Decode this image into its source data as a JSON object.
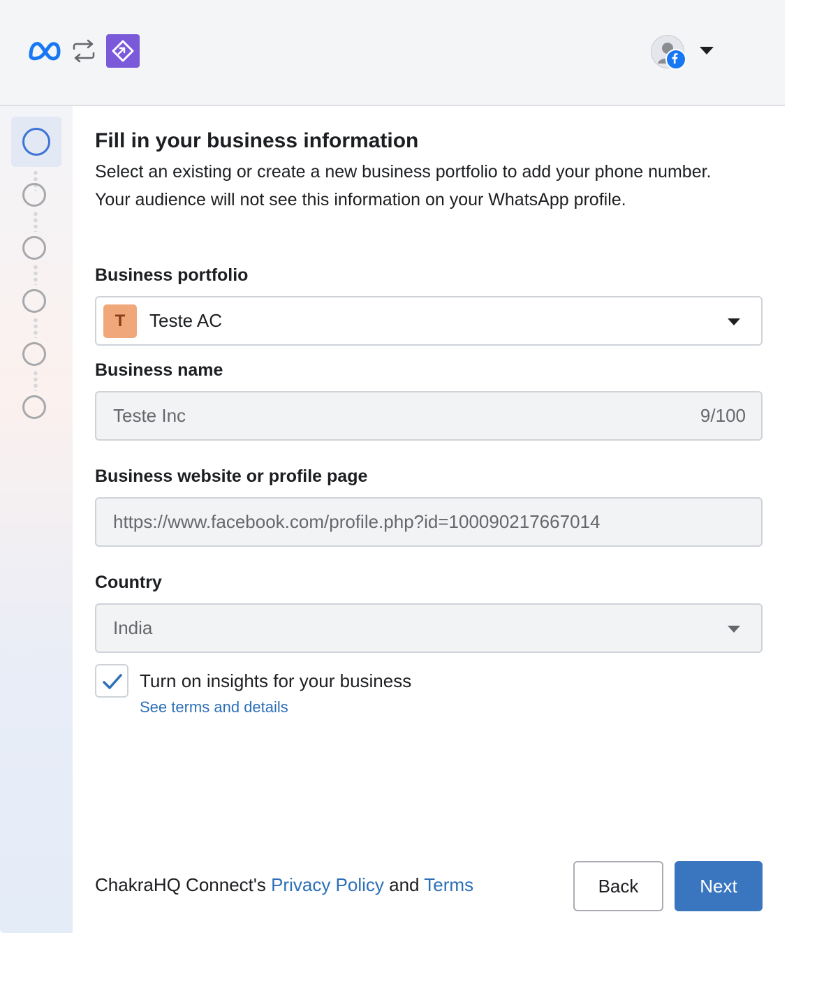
{
  "header": {
    "meta_logo_icon": "meta-infinity-icon",
    "swap_icon": "swap-arrows-icon",
    "app_logo_icon": "chakra-app-icon",
    "avatar_icon": "profile-avatar-icon",
    "facebook_badge_icon": "facebook-badge-icon",
    "account_menu_icon": "caret-down-icon"
  },
  "stepper": {
    "steps": [
      "active",
      "pending",
      "pending",
      "pending",
      "pending",
      "pending"
    ]
  },
  "main": {
    "title": "Fill in your business information",
    "subtitle": "Select an existing or create a new business portfolio to add your phone number. Your audience will not see this information on your WhatsApp profile.",
    "portfolio": {
      "label": "Business portfolio",
      "badge": "T",
      "value": "Teste AC"
    },
    "business_name": {
      "label": "Business name",
      "value": "Teste Inc",
      "counter": "9/100"
    },
    "website": {
      "label": "Business website or profile page",
      "value": "https://www.facebook.com/profile.php?id=100090217667014"
    },
    "country": {
      "label": "Country",
      "value": "India"
    },
    "insights": {
      "checked": true,
      "label": "Turn on insights for your business",
      "link": "See terms and details"
    }
  },
  "footer": {
    "prefix": "ChakraHQ Connect's",
    "privacy_link": "Privacy Policy",
    "and": "and",
    "terms_link": "Terms",
    "back_label": "Back",
    "next_label": "Next"
  },
  "colors": {
    "accent": "#3a76c0",
    "link": "#2c6fb7",
    "app_logo": "#7b5ad9",
    "active_step": "#3b73d6"
  }
}
